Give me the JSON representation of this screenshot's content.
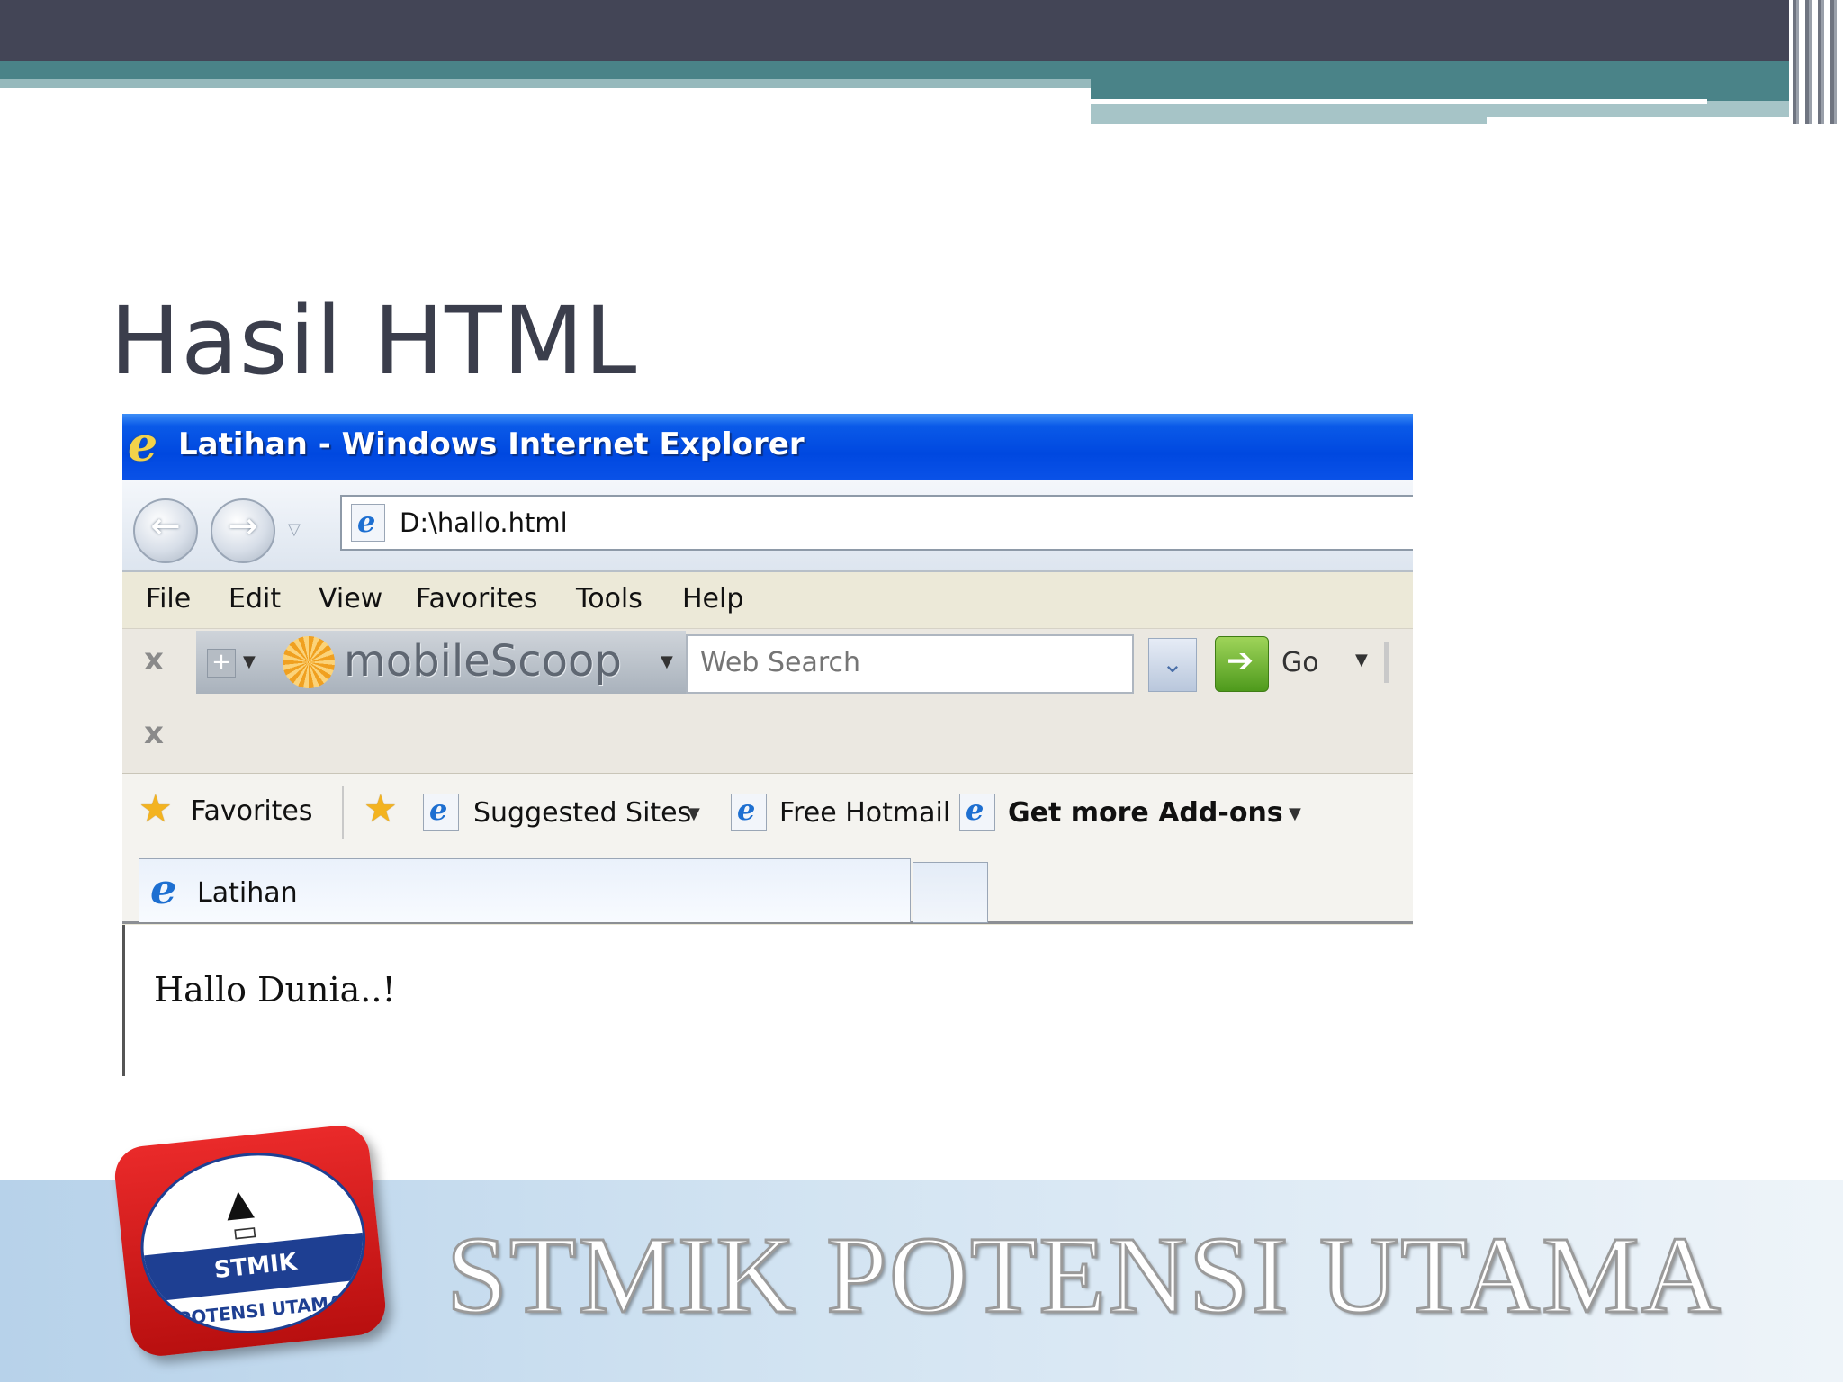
{
  "slide": {
    "title": "Hasil HTML",
    "footer_text": "STMIK POTENSI UTAMA",
    "logo": {
      "label": "STMIK",
      "arc_text": "POTENSI UTAMA"
    }
  },
  "browser": {
    "window_title": "Latihan - Windows Internet Explorer",
    "address": "D:\\hallo.html",
    "menu": [
      "File",
      "Edit",
      "View",
      "Favorites",
      "Tools",
      "Help"
    ],
    "toolbar": {
      "brand": "mobileScoop",
      "search_placeholder": "Web Search",
      "go_label": "Go"
    },
    "favorites_bar": {
      "favorites_label": "Favorites",
      "items": [
        "Suggested Sites",
        "Free Hotmail",
        "Get more Add-ons"
      ]
    },
    "tab_label": "Latihan",
    "content_text": "Hallo Dunia..!"
  },
  "colors": {
    "titlebar_blue": "#0a52e8",
    "slide_dark": "#434556",
    "slide_teal": "#4a8388",
    "logo_red": "#d81e1e",
    "logo_blue": "#1e3f92"
  },
  "icons": {
    "back": "arrow-left-icon",
    "forward": "arrow-right-icon",
    "close": "close-icon",
    "go": "arrow-right-icon",
    "favorites": "star-icon",
    "page": "ie-page-icon"
  }
}
